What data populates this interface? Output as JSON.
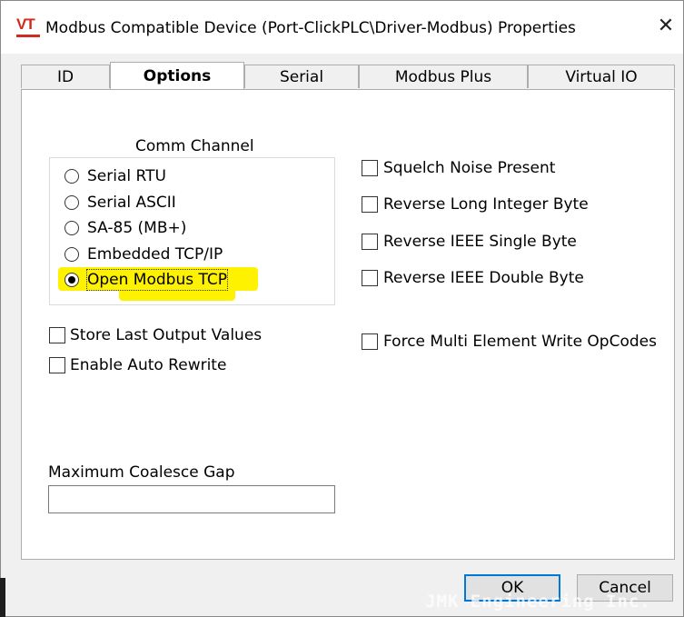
{
  "window": {
    "title": "Modbus Compatible Device (Port-ClickPLC\\Driver-Modbus) Properties",
    "app_icon_text": "VT",
    "close_glyph": "✕",
    "close_icon": "close-icon"
  },
  "tabs": [
    {
      "label": "ID",
      "active": false
    },
    {
      "label": "Options",
      "active": true
    },
    {
      "label": "Serial",
      "active": false
    },
    {
      "label": "Modbus Plus",
      "active": false
    },
    {
      "label": "Virtual IO",
      "active": false
    }
  ],
  "comm_channel": {
    "label": "Comm Channel",
    "options": [
      {
        "label": "Serial RTU",
        "selected": false
      },
      {
        "label": "Serial ASCII",
        "selected": false
      },
      {
        "label": "SA-85 (MB+)",
        "selected": false
      },
      {
        "label": "Embedded TCP/IP",
        "selected": false
      },
      {
        "label": "Open Modbus TCP",
        "selected": true
      }
    ],
    "highlight_color": "#fff200"
  },
  "left_checks": [
    {
      "label": "Store Last Output Values",
      "checked": false
    },
    {
      "label": "Enable Auto Rewrite",
      "checked": false
    }
  ],
  "right_checks": [
    {
      "label": "Squelch Noise Present",
      "checked": false
    },
    {
      "label": "Reverse Long Integer Byte",
      "checked": false
    },
    {
      "label": "Reverse IEEE Single Byte",
      "checked": false
    },
    {
      "label": "Reverse IEEE Double Byte",
      "checked": false
    },
    {
      "label": "Force Multi Element Write OpCodes",
      "checked": false
    }
  ],
  "coalesce": {
    "label": "Maximum Coalesce Gap",
    "value": ""
  },
  "buttons": {
    "ok": "OK",
    "cancel": "Cancel"
  },
  "watermark": "JMK Engineering Inc.",
  "colors": {
    "dialog_bg": "#f0f0f0",
    "panel_bg": "#ffffff",
    "accent": "#0078d7",
    "icon_red": "#d12a1f"
  }
}
